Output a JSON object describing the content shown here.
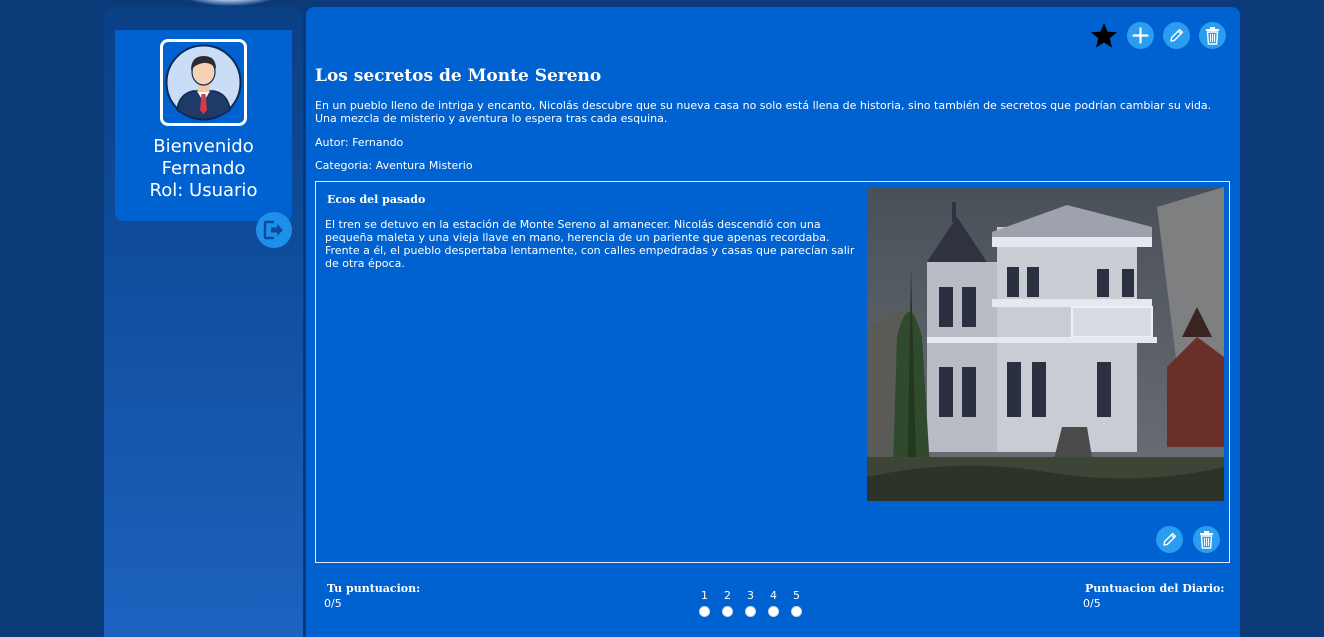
{
  "sidebar": {
    "welcome": "Bienvenido",
    "user_name": "Fernando",
    "role": "Rol: Usuario",
    "avatar_icon": "user-avatar-icon",
    "logout_icon": "logout-icon"
  },
  "toolbar": {
    "favorite_icon": "star-icon",
    "add_icon": "plus-icon",
    "edit_icon": "pencil-icon",
    "delete_icon": "trash-icon"
  },
  "diary": {
    "title": "Los secretos de Monte Sereno",
    "description": "En un pueblo lleno de intriga y encanto, Nicolás descubre que su nueva casa no solo está llena de historia, sino también de secretos que podrían cambiar su vida. Una mezcla de misterio y aventura lo espera tras cada esquina.",
    "author": "Autor: Fernando",
    "category": "Categoria: Aventura Misterio"
  },
  "chapter": {
    "title": "Ecos del pasado",
    "text": "El tren se detuvo en la estación de Monte Sereno al amanecer. Nicolás descendió con una pequeña maleta y una vieja llave en mano, herencia de un pariente que apenas recordaba. Frente a él, el pueblo despertaba lentamente, con calles empedradas y casas que parecían salir de otra época."
  },
  "ratings": {
    "user_label": "Tu puntuacion:",
    "user_value": "0/5",
    "diary_label": "Puntuacion del Diario:",
    "diary_value": "0/5",
    "options": [
      "1",
      "2",
      "3",
      "4",
      "5"
    ]
  },
  "colors": {
    "background": "#0a3a78",
    "panel": "#0062d0",
    "button": "#2a9df0"
  }
}
